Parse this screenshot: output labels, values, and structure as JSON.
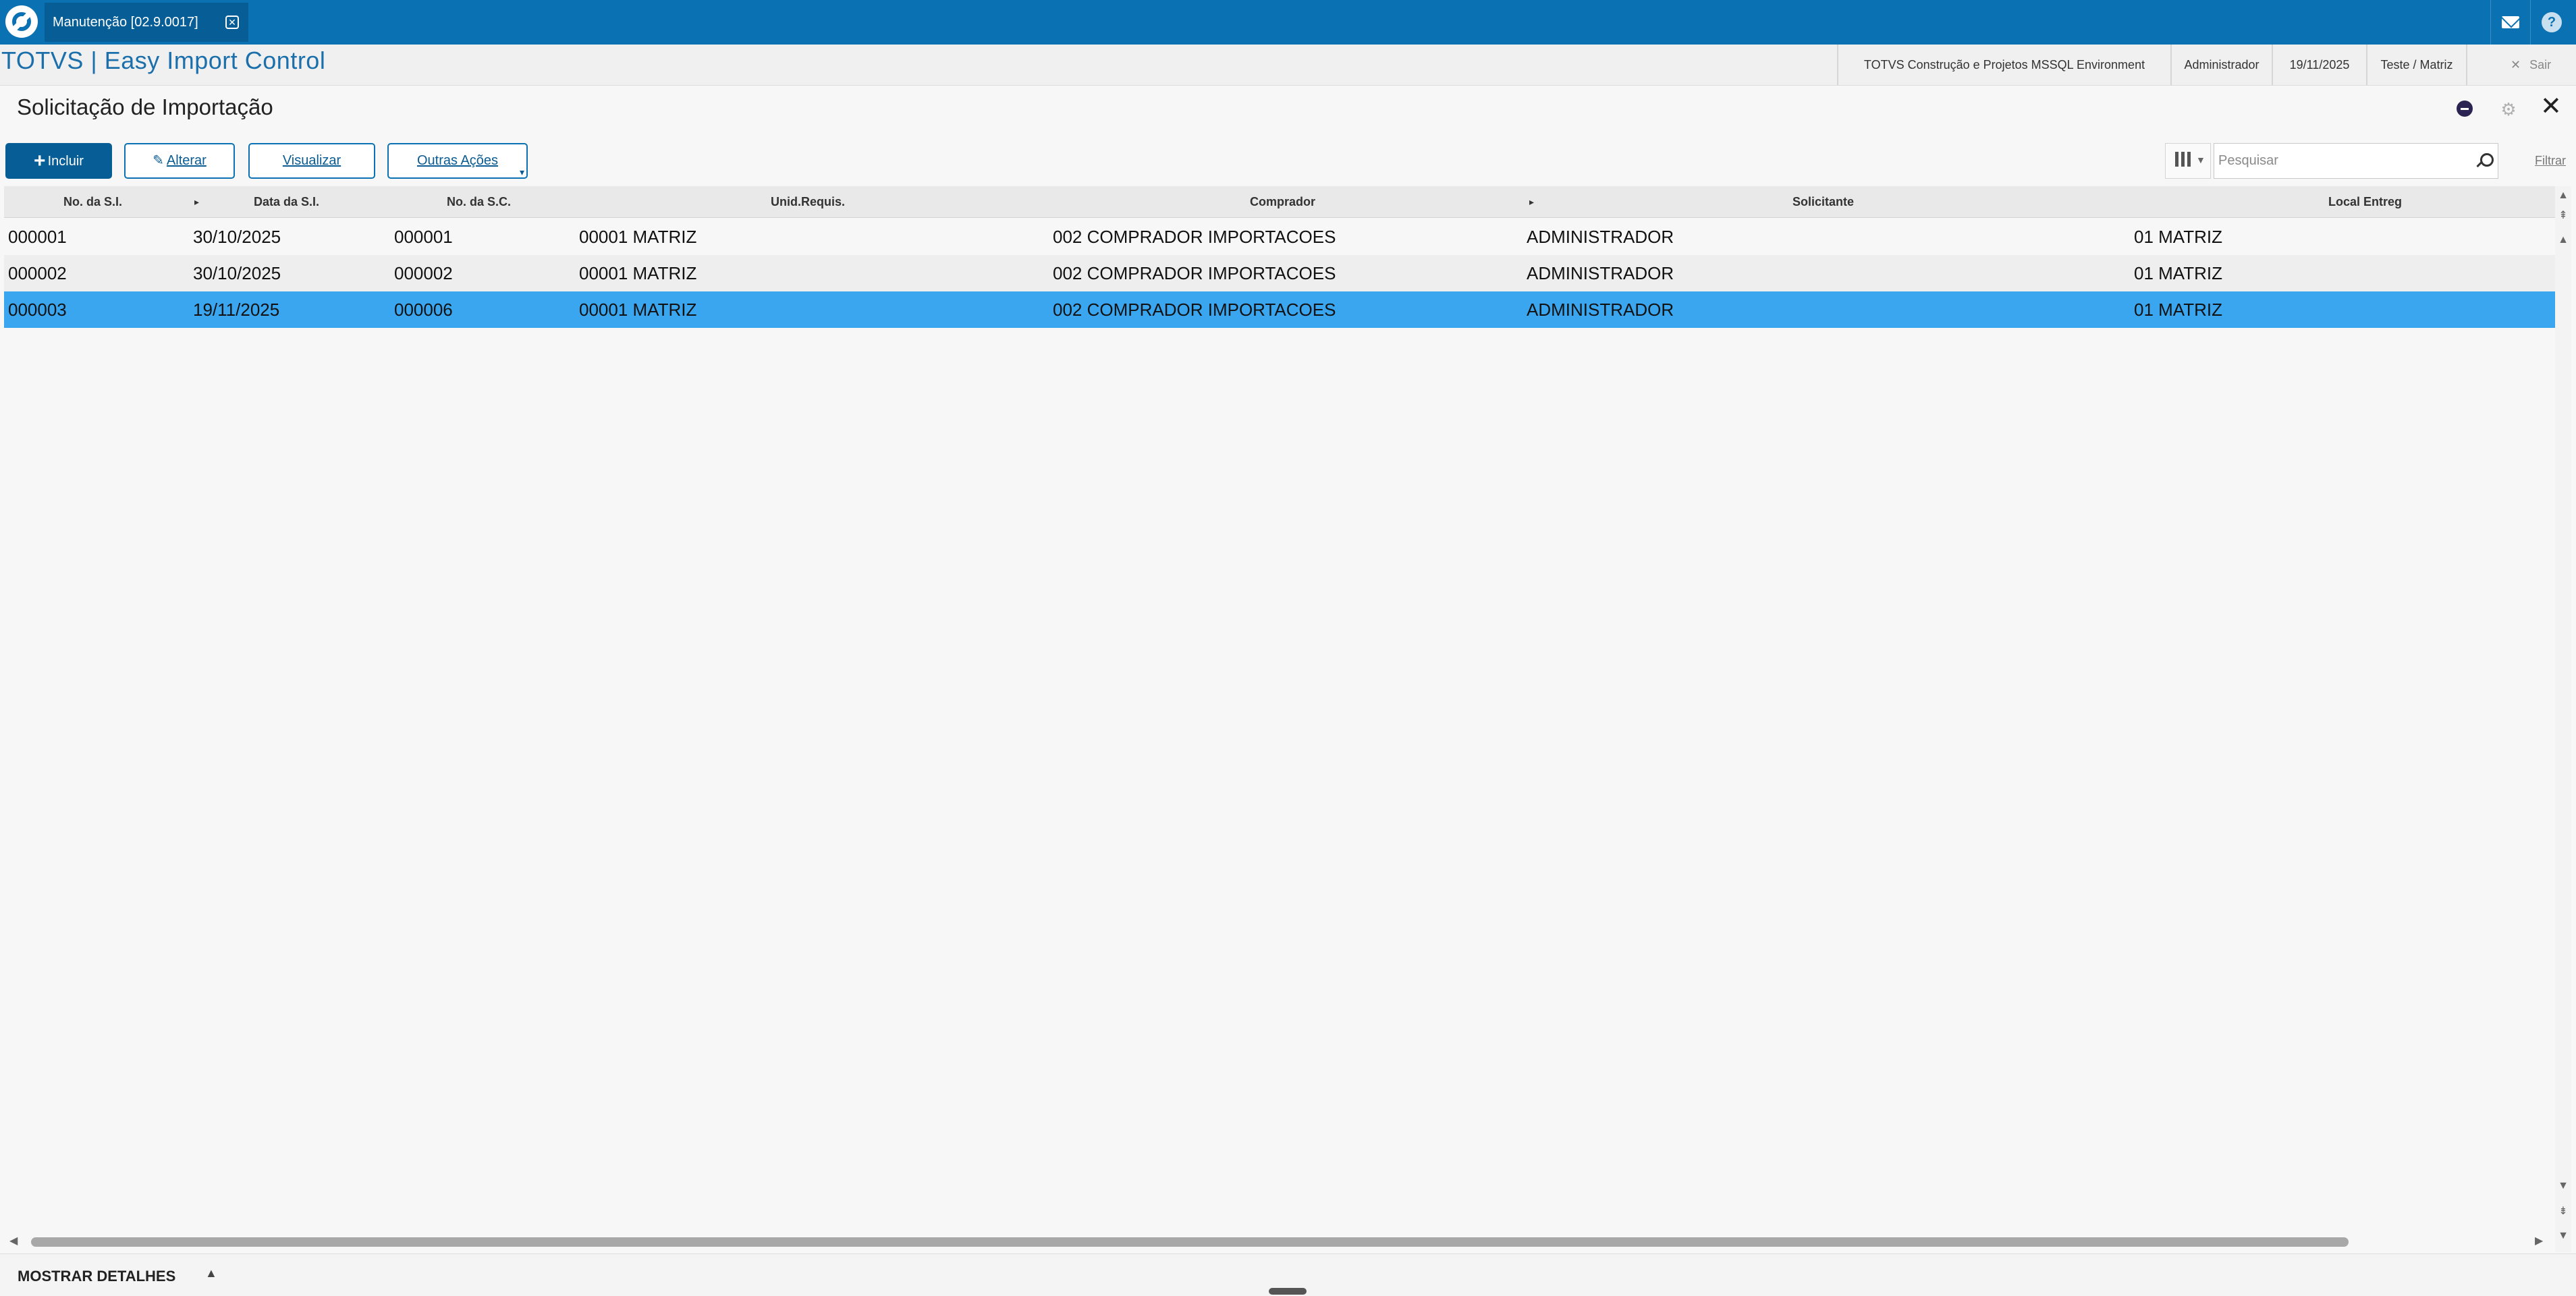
{
  "topbar": {
    "tab_label": "Manutenção [02.9.0017]",
    "tab_close_glyph": "✕",
    "icons": [
      "totvs-logo-icon",
      "mail-icon",
      "help-icon"
    ]
  },
  "header": {
    "app_title": "TOTVS | Easy Import Control",
    "environment": "TOTVS Construção e Projetos MSSQL Environment",
    "user": "Administrador",
    "date": "19/11/2025",
    "branch": "Teste / Matriz",
    "logout_label": "Sair",
    "logout_glyph": "✕"
  },
  "page": {
    "title": "Solicitação de Importação",
    "close_glyph": "✕",
    "settings_glyph": "⚙"
  },
  "toolbar": {
    "include_label": "Incluir",
    "include_glyph": "+",
    "edit_label": "Alterar",
    "edit_glyph": "✎",
    "view_label": "Visualizar",
    "other_actions_label": "Outras Ações",
    "other_actions_caret": "▾",
    "search_placeholder": "Pesquisar",
    "filter_label": "Filtrar"
  },
  "grid": {
    "columns": [
      "No. da S.I.",
      "Data da S.I.",
      "No. da S.C.",
      "Unid.Requis.",
      "Comprador",
      "Solicitante",
      "Local Entreg"
    ],
    "sort_marker": "▸",
    "rows": [
      [
        "000001",
        "30/10/2025",
        "000001",
        "00001 MATRIZ",
        "002 COMPRADOR IMPORTACOES",
        "ADMINISTRADOR",
        "01 MATRIZ"
      ],
      [
        "000002",
        "30/10/2025",
        "000002",
        "00001 MATRIZ",
        "002 COMPRADOR IMPORTACOES",
        "ADMINISTRADOR",
        "01 MATRIZ"
      ],
      [
        "000003",
        "19/11/2025",
        "000006",
        "00001 MATRIZ",
        "002 COMPRADOR IMPORTACOES",
        "ADMINISTRADOR",
        "01 MATRIZ"
      ]
    ],
    "selected_row": 3
  },
  "footer": {
    "details_label": "MOSTRAR DETALHES",
    "details_caret": "▲"
  },
  "colors": {
    "topbar": "#0a72b3",
    "tab": "#075e96",
    "accent": "#1b6fab",
    "selected_row": "#3aa6f0"
  }
}
